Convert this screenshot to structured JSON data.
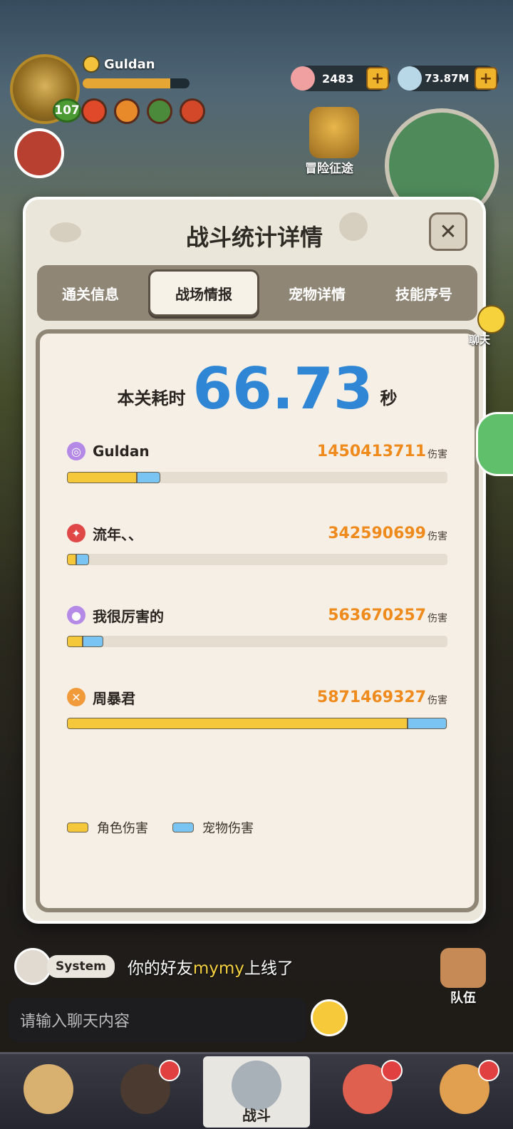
{
  "hud": {
    "player_name": "Guldan",
    "level": "107",
    "gems": "2483",
    "coins": "73.87M",
    "plus_label": "+",
    "adventure_label": "冒险征途"
  },
  "modal": {
    "title": "战斗统计详情",
    "close_label": "✕",
    "tabs": [
      {
        "label": "通关信息"
      },
      {
        "label": "战场情报"
      },
      {
        "label": "宠物详情"
      },
      {
        "label": "技能序号"
      }
    ],
    "active_tab": 1,
    "time": {
      "label": "本关耗时",
      "value": "66.73",
      "unit": "秒"
    },
    "damage_unit": "伤害",
    "players": [
      {
        "name": "Guldan",
        "damage": "1450413711",
        "icon": "swirl-icon",
        "color": "#b48ae6",
        "char_frac": 0.184,
        "pet_frac": 0.062
      },
      {
        "name": "流年、、",
        "damage": "342590699",
        "icon": "fox-icon",
        "color": "#e04848",
        "char_frac": 0.024,
        "pet_frac": 0.034
      },
      {
        "name": "我很厉害的",
        "damage": "563670257",
        "icon": "orb-icon",
        "color": "#b48ae6",
        "char_frac": 0.042,
        "pet_frac": 0.054
      },
      {
        "name": "周暴君",
        "damage": "5871469327",
        "icon": "slash-icon",
        "color": "#f09a3a",
        "char_frac": 0.895,
        "pet_frac": 0.103
      }
    ],
    "legend": {
      "char_label": "角色伤害",
      "pet_label": "宠物伤害",
      "char_color": "#f5c83c",
      "pet_color": "#79c4f2"
    }
  },
  "chat": {
    "side_label": "聊天",
    "system_tag": "System",
    "message_before": "你的好友",
    "message_highlight": "mymy",
    "message_after": "上线了",
    "input_placeholder": "请输入聊天内容",
    "team_label": "队伍"
  },
  "bottom_nav": {
    "center_label": "战斗"
  }
}
